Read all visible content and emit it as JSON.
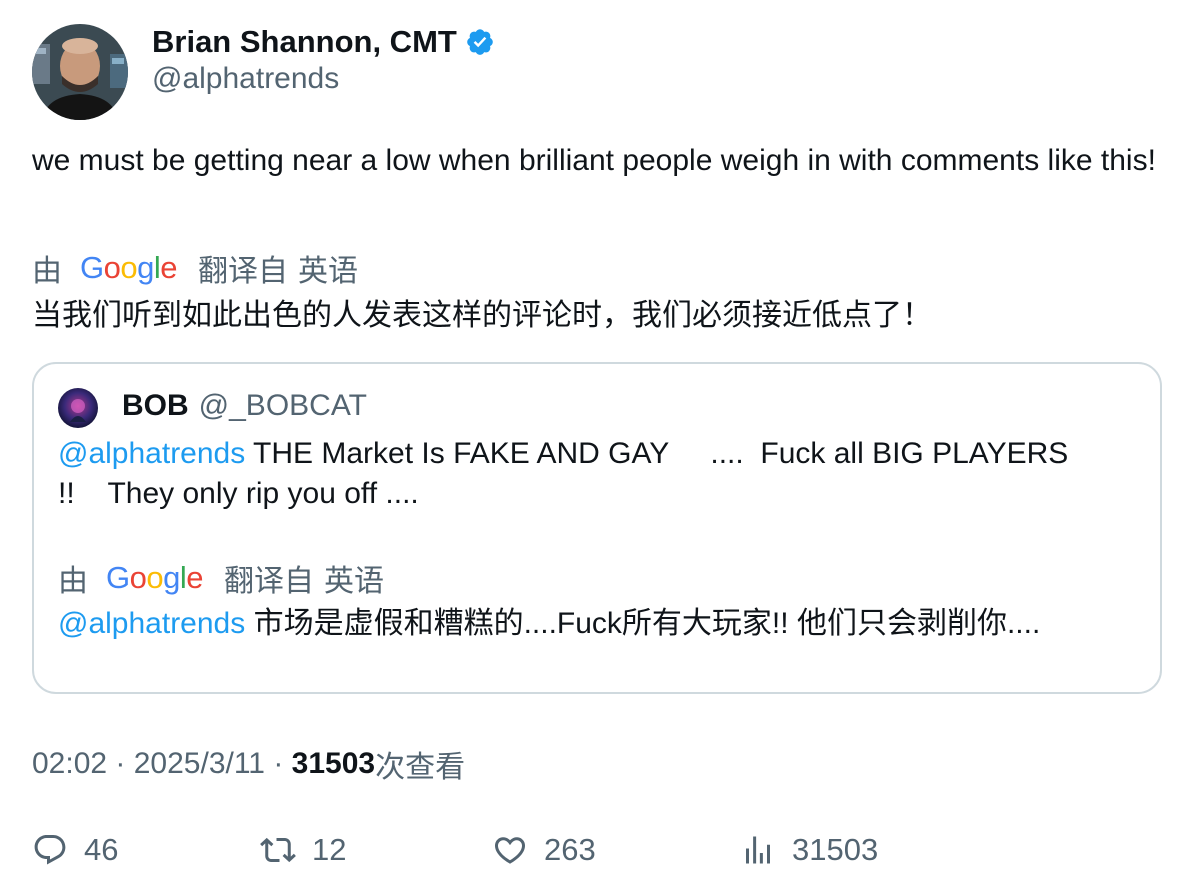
{
  "author": {
    "name": "Brian Shannon, CMT",
    "handle": "@alphatrends",
    "verified_color": "#1d9bf0"
  },
  "tweet": {
    "text": "we must be getting near a low when brilliant people weigh in with comments like this!",
    "translation": {
      "by": "由",
      "provider": "Google",
      "translated_from": "翻译自",
      "language": "英语",
      "text": "当我们听到如此出色的人发表这样的评论时，我们必须接近低点了！"
    }
  },
  "quote": {
    "name": "BOB",
    "handle": "@_BOBCAT",
    "mention": "@alphatrends",
    "text_line1": " THE Market Is FAKE AND GAY     ....  Fuck all BIG PLAYERS",
    "text_line2": "!!    They only rip you off ....",
    "translation": {
      "by": "由",
      "provider": "Google",
      "translated_from": "翻译自",
      "language": "英语",
      "mention": "@alphatrends",
      "text": " 市场是虚假和糟糕的....Fuck所有大玩家!! 他们只会剥削你...."
    }
  },
  "meta": {
    "time": "02:02",
    "sep1": " · ",
    "date": "2025/3/11",
    "sep2": " · ",
    "views": "31503",
    "views_label": "次查看"
  },
  "actions": {
    "replies": "46",
    "retweets": "12",
    "likes": "263",
    "views": "31503"
  },
  "colors": {
    "accent": "#1d9bf0",
    "secondary_text": "#536471",
    "border": "#cfd9de"
  }
}
